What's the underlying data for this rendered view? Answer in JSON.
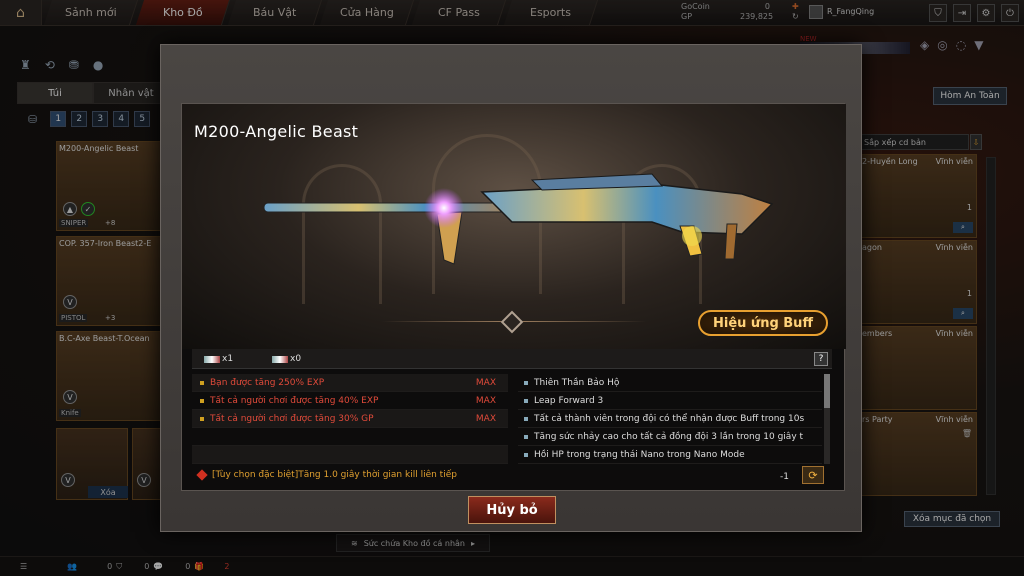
{
  "nav": {
    "tabs": [
      {
        "label": "Sảnh mới"
      },
      {
        "label": "Kho Đồ"
      },
      {
        "label": "Báu Vật"
      },
      {
        "label": "Cửa Hàng"
      },
      {
        "label": "CF Pass"
      },
      {
        "label": "Esports"
      }
    ],
    "active_tab": "Kho Đồ",
    "gocoin_label": "GoCoin",
    "gocoin_value": "0",
    "gp_label": "GP",
    "gp_value": "239,825",
    "username": "R_FangQing",
    "new_badge": "NEW"
  },
  "left_panel": {
    "subtabs": [
      {
        "label": "Túi"
      },
      {
        "label": "Nhân vật"
      }
    ],
    "pages": [
      "1",
      "2",
      "3",
      "4",
      "5"
    ],
    "items": [
      {
        "name": "M200-Angelic Beast",
        "type": "SNIPER",
        "level": "+8"
      },
      {
        "name": "COP. 357-Iron Beast2-E",
        "type": "PISTOL",
        "level": "+3"
      },
      {
        "name": "B.C-Axe Beast-T.Ocean",
        "type": "Knife",
        "level": ""
      }
    ],
    "delete_label": "Xóa"
  },
  "right_panel": {
    "safe_button": "Hòm An Toàn",
    "sort_label": "Sắp xếp cd bản",
    "items": [
      {
        "name": "2-Huyền Long",
        "duration": "Vĩnh viễn",
        "count": "1"
      },
      {
        "name": "agon",
        "duration": "Vĩnh viễn",
        "count": "1"
      },
      {
        "name": "embers",
        "duration": "Vĩnh viễn",
        "count": ""
      },
      {
        "name": "rs Party",
        "duration": "Vĩnh viễn",
        "count": ""
      }
    ],
    "clear_button": "Xóa mục đã chọn"
  },
  "bottom": {
    "capacity_label": "Sức chứa Kho đồ cá nhân",
    "counts": [
      "0",
      "0",
      "0",
      "2"
    ]
  },
  "modal": {
    "title": "M200-Angelic Beast",
    "buff_button": "Hiệu ứng Buff",
    "chip1": "x1",
    "chip2": "x0",
    "help": "?",
    "buffs_left": [
      {
        "text": "Bạn được tăng 250%  EXP",
        "max": "MAX"
      },
      {
        "text": "Tất cả người chơi được tăng 40% EXP",
        "max": "MAX"
      },
      {
        "text": "Tất cả người chơi được tăng 30% GP",
        "max": "MAX"
      }
    ],
    "buffs_right": [
      "Thiên Thần Bảo Hộ",
      "Leap Forward 3",
      "Tất cả thành viên trong đội có thể nhận được Buff trong 10s",
      "Tăng sức nhảy cao cho tất cả đồng đội 3 lần trong 10 giây t",
      "Hồi HP trong trạng thái Nano trong Nano Mode"
    ],
    "special_option": "[Tùy chọn đặc biệt]Tăng 1.0 giây thời gian kill liên tiếp",
    "special_count": "-1",
    "cancel_button": "Hủy bỏ"
  }
}
